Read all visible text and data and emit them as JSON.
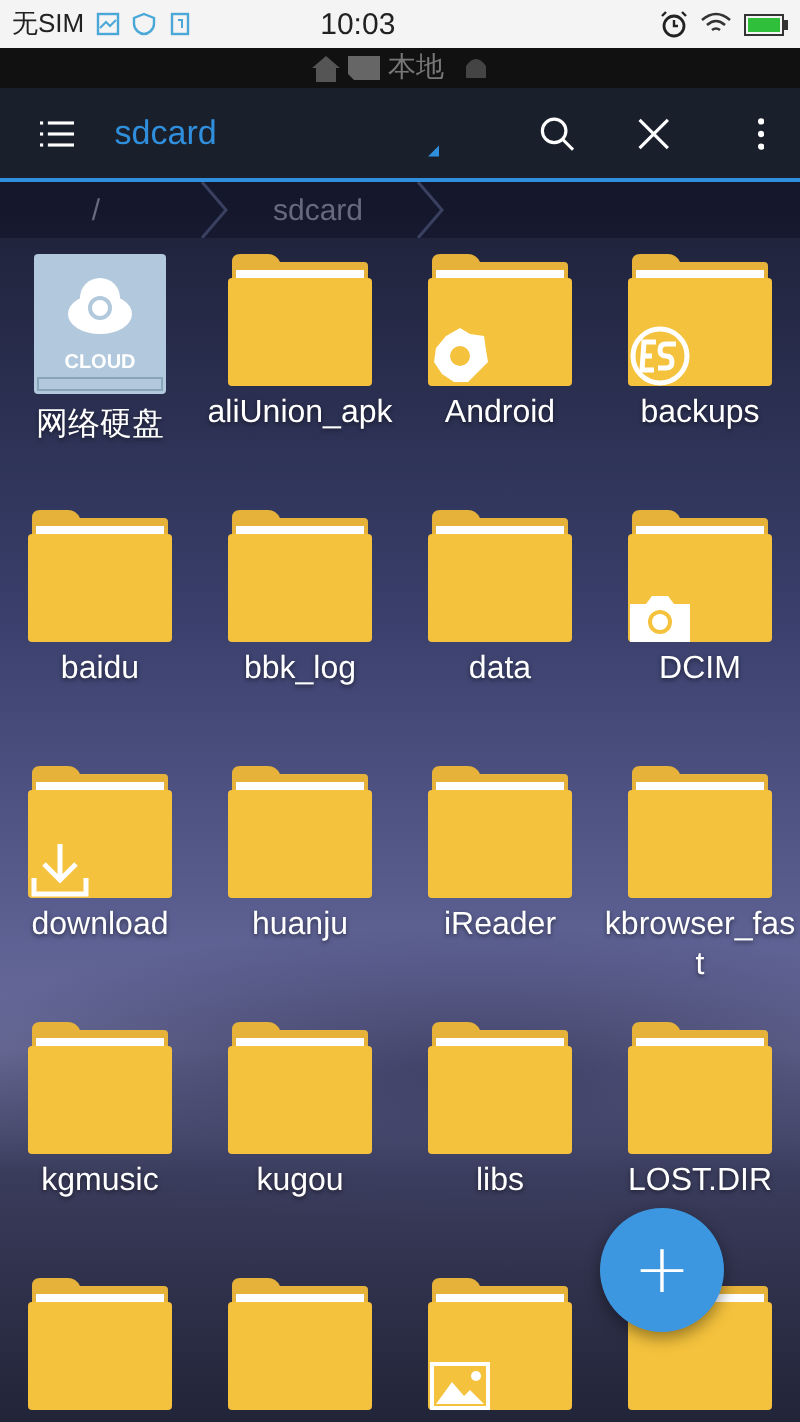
{
  "status_bar": {
    "carrier": "无SIM",
    "time": "10:03"
  },
  "location_bar": {
    "label": "本地"
  },
  "toolbar": {
    "title": "sdcard"
  },
  "breadcrumb": [
    {
      "label": "/"
    },
    {
      "label": "sdcard"
    }
  ],
  "items": [
    {
      "kind": "cloud",
      "name": "网络硬盘",
      "cloud_label": "CLOUD"
    },
    {
      "kind": "folder",
      "name": "aliUnion_apk"
    },
    {
      "kind": "gear_folder",
      "name": "Android"
    },
    {
      "kind": "es_folder",
      "name": "backups"
    },
    {
      "kind": "folder",
      "name": "baidu"
    },
    {
      "kind": "folder",
      "name": "bbk_log"
    },
    {
      "kind": "folder",
      "name": "data"
    },
    {
      "kind": "camera_folder",
      "name": "DCIM"
    },
    {
      "kind": "download_folder",
      "name": "download"
    },
    {
      "kind": "folder",
      "name": "huanju"
    },
    {
      "kind": "folder",
      "name": "iReader"
    },
    {
      "kind": "folder",
      "name": "kbrowser_fast"
    },
    {
      "kind": "folder",
      "name": "kgmusic"
    },
    {
      "kind": "folder",
      "name": "kugou"
    },
    {
      "kind": "folder",
      "name": "libs"
    },
    {
      "kind": "folder",
      "name": "LOST.DIR"
    },
    {
      "kind": "folder"
    },
    {
      "kind": "folder"
    },
    {
      "kind": "image_folder"
    },
    {
      "kind": "folder"
    }
  ],
  "fab": {
    "symbol": "+"
  }
}
